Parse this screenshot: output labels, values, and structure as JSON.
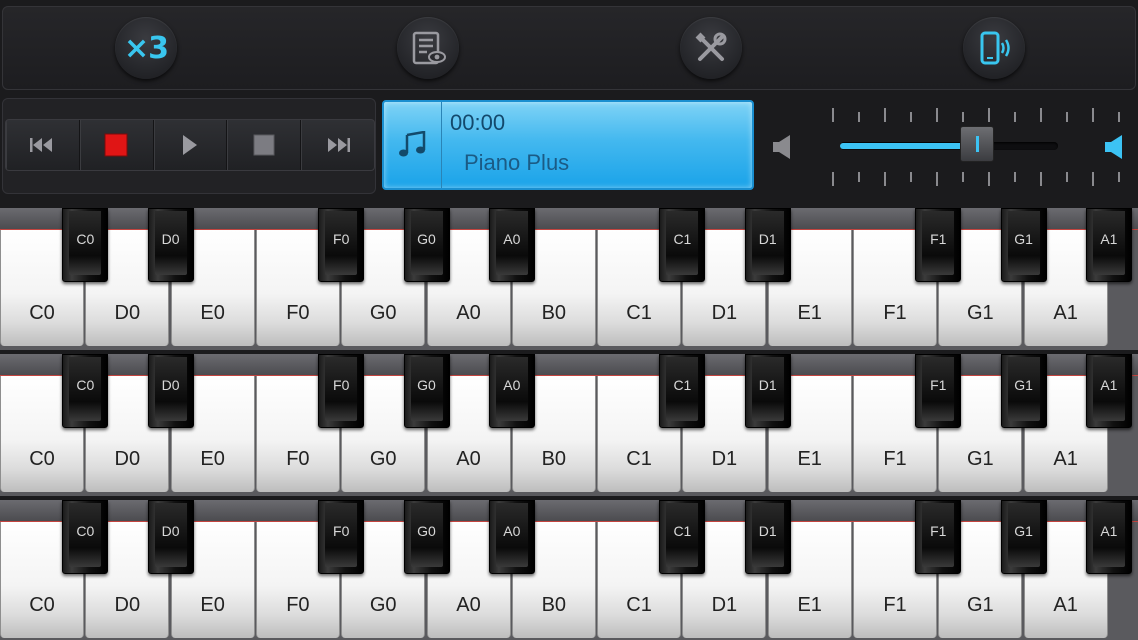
{
  "toolbar": {
    "multiplier_label": "×3",
    "icons": [
      "x3-icon",
      "record-list-icon",
      "settings-tools-icon",
      "phone-vibrate-icon"
    ]
  },
  "transport": {
    "buttons": [
      "skip-back-icon",
      "record-icon",
      "play-icon",
      "stop-icon",
      "skip-forward-icon"
    ]
  },
  "display": {
    "time": "00:00",
    "song": "Piano Plus",
    "icon": "music-note-icon"
  },
  "volume": {
    "level_fraction": 0.63
  },
  "colors": {
    "accent": "#3cc3f4",
    "record": "#e01515",
    "display_bg": "#43b8ef"
  },
  "keyboards": [
    {
      "white_keys": [
        "C0",
        "D0",
        "E0",
        "F0",
        "G0",
        "A0",
        "B0",
        "C1",
        "D1",
        "E1",
        "F1",
        "G1",
        "A1"
      ],
      "black_keys": [
        "C0",
        "D0",
        "F0",
        "G0",
        "A0",
        "C1",
        "D1",
        "F1",
        "G1",
        "A1"
      ]
    },
    {
      "white_keys": [
        "C0",
        "D0",
        "E0",
        "F0",
        "G0",
        "A0",
        "B0",
        "C1",
        "D1",
        "E1",
        "F1",
        "G1",
        "A1"
      ],
      "black_keys": [
        "C0",
        "D0",
        "F0",
        "G0",
        "A0",
        "C1",
        "D1",
        "F1",
        "G1",
        "A1"
      ]
    },
    {
      "white_keys": [
        "C0",
        "D0",
        "E0",
        "F0",
        "G0",
        "A0",
        "B0",
        "C1",
        "D1",
        "E1",
        "F1",
        "G1",
        "A1"
      ],
      "black_keys": [
        "C0",
        "D0",
        "F0",
        "G0",
        "A0",
        "C1",
        "D1",
        "F1",
        "G1",
        "A1"
      ]
    }
  ]
}
